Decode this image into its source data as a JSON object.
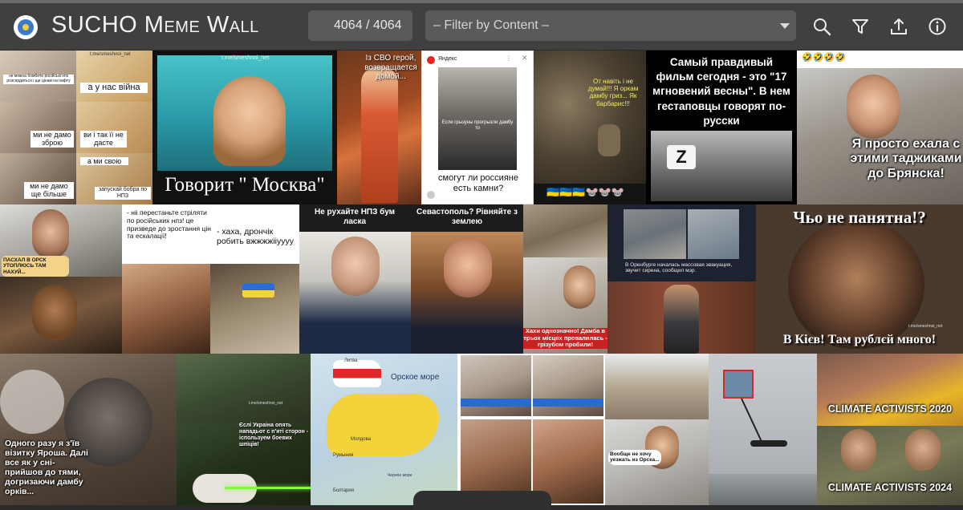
{
  "app": {
    "title": "SUCHO Meme Wall",
    "counter": "4064 / 4064",
    "filter_placeholder": "– Filter by Content –"
  },
  "toolbar": {
    "icons": [
      "search-icon",
      "filter-icon",
      "upload-icon",
      "info-icon"
    ]
  },
  "colors": {
    "header_bg": "#404040",
    "field_bg": "#5a5a5a",
    "text": "#f2f2f2"
  },
  "memes": {
    "t1": {
      "watermark": "t.me/smeshnoi_net",
      "c1": "не можна бомбити російські нпз розсердиться і ще цінам на нафту",
      "c2": "а у нас війна",
      "c3": "ми не дамо зброю",
      "c4": "ви і так її не дасте",
      "c5": "ми не дамо ще більше",
      "c6": "а ми свою",
      "c7": "запускай бобра по НПЗ"
    },
    "t2": {
      "watermark": "t.me/smeshnoi_net",
      "caption": "Говорит \" Москва\""
    },
    "t3": {
      "caption": "Із СВО герой, возвращается домой..."
    },
    "t4": {
      "brand": "Яндекс",
      "inner": "Если грызуны прогрызли дамбу то",
      "caption": "смогут ли россияне есть камни?"
    },
    "t5": {
      "caption": "От навіть і не думай!!! Я оркам дамбу гриз... Як барбарис!!!",
      "footer": "🇺🇦🇺🇦🇺🇦🐭🐭🐭"
    },
    "t6": {
      "caption": "Самый правдивый фильм сегодня - это \"17 мгновений весны\". В нем гестаповцы говорят по-русски"
    },
    "t7": {
      "emoji": "🤣🤣🤣🤣",
      "caption": "Я просто ехала с этими таджиками до Брянска!"
    },
    "t8": {
      "caption": "ПАСХАЛ В ОРСК УТОПЛЮСЬ ТАМ НАХУЙ..."
    },
    "t9": {
      "c1": "- ніі перестаньте стріляти по російських нпз! це призведе до зростання цін та ескалації!",
      "c2": "- хаха, дрончік робить вжжжжііуууу"
    },
    "t10": {
      "c1": "Не рухайте НПЗ бум ласка",
      "c2": "Севастополь? Рівняйте з землею"
    },
    "t11": {
      "caption": "Хахи однозначно! Дамба в трьох місцях провалилась - грізубом пробили!"
    },
    "t12": {
      "caption": "В Оренбурге началась массовая эвакуация, звучит сирена, сообщил мэр."
    },
    "t13": {
      "top": "Чьо не панятна!?",
      "bottom": "В Кієв! Там рублєй много!",
      "watermark": "t.me/smeshnoi_net"
    },
    "t14": {
      "caption": "Одного разу я з'їв візитку Яроша. Далі все як у сні- прийшов до тями, догризаючи дамбу орків..."
    },
    "t15": {
      "watermark": "t.me/smeshnoi_net",
      "caption": "Єслі Украіна опять нападьот с п'яті сторон - іспользуем боевих шпіців!"
    },
    "t16": {
      "sea": "Орское море",
      "label1": "Литва",
      "label2": "Молдова",
      "label3": "Румыния",
      "label4": "Болгария",
      "label5": "Черное море"
    },
    "t17": {
      "caption": "Вообще не хочу уезжать из Орска..."
    },
    "t18": {
      "top": "CLIMATE ACTIVISTS 2020",
      "bottom": "CLIMATE ACTIVISTS 2024"
    }
  }
}
